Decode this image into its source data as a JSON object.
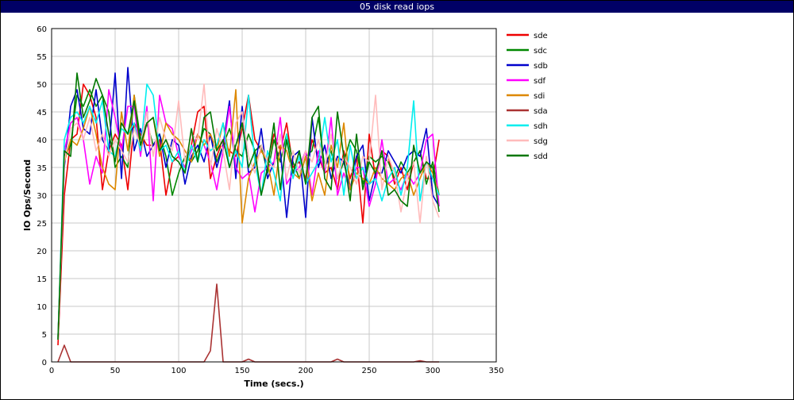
{
  "window": {
    "title": "05 disk read iops"
  },
  "chart_data": {
    "type": "line",
    "title": "05 disk read iops",
    "xlabel": "Time (secs.)",
    "ylabel": "IO Ops/Second",
    "xlim": [
      0,
      350
    ],
    "ylim": [
      0,
      60
    ],
    "xticks": [
      0,
      50,
      100,
      150,
      200,
      250,
      300,
      350
    ],
    "yticks": [
      0,
      5,
      10,
      15,
      20,
      25,
      30,
      35,
      40,
      45,
      50,
      55,
      60
    ],
    "grid": true,
    "legend_position": "right",
    "x": [
      5,
      10,
      15,
      20,
      25,
      30,
      35,
      40,
      45,
      50,
      55,
      60,
      65,
      70,
      75,
      80,
      85,
      90,
      95,
      100,
      105,
      110,
      115,
      120,
      125,
      130,
      135,
      140,
      145,
      150,
      155,
      160,
      165,
      170,
      175,
      180,
      185,
      190,
      195,
      200,
      205,
      210,
      215,
      220,
      225,
      230,
      235,
      240,
      245,
      250,
      255,
      260,
      265,
      270,
      275,
      280,
      285,
      290,
      295,
      300,
      305
    ],
    "series": [
      {
        "name": "sde",
        "color": "#ee0000",
        "values": [
          3,
          30,
          40,
          41,
          50,
          48,
          44,
          31,
          38,
          41,
          39,
          31,
          43,
          41,
          39,
          39,
          40,
          30,
          36,
          37,
          35,
          39,
          45,
          46,
          33,
          37,
          40,
          38,
          37,
          42,
          48,
          40,
          38,
          36,
          41,
          38,
          43,
          35,
          36,
          33,
          40,
          37,
          34,
          35,
          31,
          38,
          33,
          37,
          25,
          41,
          33,
          38,
          37,
          32,
          35,
          31,
          36,
          38,
          33,
          33,
          40
        ]
      },
      {
        "name": "sdc",
        "color": "#008800",
        "values": [
          4,
          37,
          39,
          48,
          46,
          49,
          46,
          48,
          45,
          35,
          37,
          35,
          48,
          40,
          43,
          39,
          41,
          37,
          30,
          34,
          37,
          36,
          38,
          42,
          41,
          36,
          39,
          42,
          38,
          37,
          41,
          38,
          39,
          34,
          40,
          36,
          41,
          36,
          33,
          37,
          38,
          44,
          35,
          38,
          33,
          36,
          40,
          38,
          32,
          37,
          36,
          37,
          36,
          33,
          36,
          34,
          36,
          38,
          32,
          36,
          30
        ]
      },
      {
        "name": "sdb",
        "color": "#0000cc",
        "values": [
          4,
          35,
          46,
          49,
          42,
          41,
          49,
          40,
          38,
          52,
          33,
          53,
          38,
          42,
          37,
          39,
          41,
          35,
          40,
          39,
          32,
          37,
          39,
          36,
          41,
          35,
          39,
          47,
          33,
          46,
          34,
          35,
          42,
          33,
          36,
          38,
          26,
          37,
          38,
          26,
          44,
          35,
          39,
          33,
          37,
          36,
          31,
          37,
          39,
          29,
          34,
          34,
          38,
          36,
          34,
          37,
          38,
          37,
          42,
          30,
          28
        ]
      },
      {
        "name": "sdf",
        "color": "#ff00ff",
        "values": [
          4,
          38,
          43,
          44,
          40,
          32,
          37,
          34,
          49,
          44,
          38,
          46,
          46,
          37,
          46,
          29,
          48,
          43,
          42,
          37,
          35,
          38,
          41,
          39,
          36,
          31,
          38,
          46,
          35,
          33,
          34,
          27,
          34,
          35,
          36,
          44,
          32,
          34,
          35,
          38,
          30,
          38,
          34,
          44,
          30,
          34,
          31,
          35,
          35,
          28,
          32,
          40,
          32,
          33,
          31,
          34,
          32,
          34,
          40,
          41,
          28
        ]
      },
      {
        "name": "sdi",
        "color": "#dd8800",
        "values": [
          4,
          36,
          40,
          39,
          42,
          46,
          41,
          35,
          32,
          31,
          45,
          38,
          48,
          38,
          43,
          44,
          37,
          43,
          41,
          40,
          38,
          36,
          41,
          39,
          41,
          38,
          43,
          37,
          49,
          25,
          33,
          36,
          38,
          36,
          30,
          39,
          38,
          34,
          33,
          37,
          29,
          34,
          30,
          39,
          35,
          43,
          31,
          34,
          33,
          32,
          35,
          33,
          32,
          31,
          33,
          34,
          30,
          33,
          36,
          34,
          30
        ]
      },
      {
        "name": "sda",
        "color": "#aa3333",
        "values": [
          0,
          3,
          0,
          0,
          0,
          0,
          0,
          0,
          0,
          0,
          0,
          0,
          0,
          0,
          0,
          0,
          0,
          0,
          0,
          0,
          0,
          0,
          0,
          0,
          2,
          14,
          0,
          0,
          0,
          0,
          0.5,
          0,
          0,
          0,
          0,
          0,
          0,
          0,
          0,
          0,
          0,
          0,
          0,
          0,
          0.5,
          0,
          0,
          0,
          0,
          0,
          0,
          0,
          0,
          0,
          0,
          0,
          0,
          0.2,
          0,
          0,
          0
        ]
      },
      {
        "name": "sdh",
        "color": "#00eeee",
        "values": [
          4,
          40,
          44,
          45,
          43,
          46,
          43,
          47,
          38,
          37,
          42,
          41,
          43,
          38,
          50,
          48,
          38,
          39,
          36,
          38,
          34,
          39,
          36,
          40,
          38,
          39,
          43,
          35,
          38,
          35,
          48,
          36,
          30,
          38,
          34,
          29,
          41,
          33,
          37,
          32,
          34,
          36,
          44,
          36,
          40,
          30,
          39,
          33,
          35,
          32,
          33,
          29,
          33,
          35,
          30,
          35,
          47,
          29,
          36,
          33,
          30
        ]
      },
      {
        "name": "sdg",
        "color": "#ffbbbb",
        "values": [
          4,
          36,
          42,
          43,
          40,
          44,
          38,
          41,
          37,
          40,
          38,
          36,
          42,
          39,
          45,
          37,
          44,
          40,
          38,
          47,
          36,
          41,
          40,
          50,
          35,
          42,
          38,
          31,
          43,
          45,
          37,
          34,
          39,
          36,
          35,
          41,
          33,
          38,
          34,
          38,
          36,
          40,
          35,
          41,
          33,
          37,
          35,
          32,
          37,
          36,
          48,
          31,
          37,
          34,
          27,
          33,
          36,
          25,
          37,
          29,
          26
        ]
      },
      {
        "name": "sdd",
        "color": "#007700",
        "values": [
          4,
          38,
          37,
          52,
          44,
          47,
          51,
          48,
          41,
          36,
          43,
          41,
          47,
          39,
          43,
          44,
          38,
          40,
          37,
          36,
          34,
          42,
          36,
          44,
          45,
          38,
          40,
          35,
          39,
          43,
          35,
          38,
          30,
          35,
          43,
          31,
          40,
          34,
          38,
          32,
          44,
          46,
          33,
          31,
          45,
          37,
          29,
          41,
          31,
          36,
          34,
          38,
          30,
          31,
          29,
          28,
          39,
          34,
          36,
          35,
          27
        ]
      }
    ]
  }
}
